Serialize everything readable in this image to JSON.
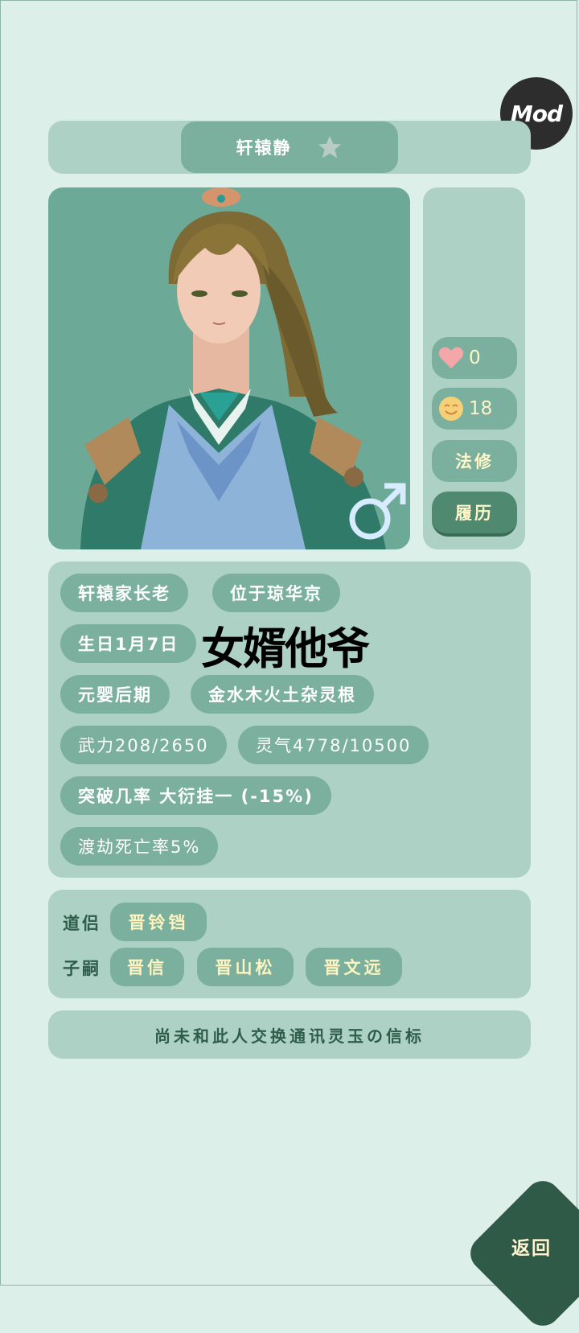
{
  "mod_badge": "Mod",
  "character": {
    "name": "轩辕静",
    "gender_icon": "male-icon"
  },
  "side_stats": {
    "affection": "0",
    "mood": "18"
  },
  "side_buttons": {
    "type": "法修",
    "history": "履历"
  },
  "info_chips": {
    "title": "轩辕家长老",
    "location": "位于琼华京",
    "birthday": "生日1月7日",
    "realm": "元婴后期",
    "root": "金水木火土杂灵根",
    "force": "武力208/2650",
    "qi": "灵气4778/10500",
    "breakthrough": "突破几率 大衍挂一 (-15%)",
    "tribulation": "渡劫死亡率5%"
  },
  "overlay_text": "女婿他爷",
  "relations": {
    "partner_label": "道侣",
    "partner": "晋铃铛",
    "children_label": "子嗣",
    "children": [
      "晋信",
      "晋山松",
      "晋文远"
    ]
  },
  "beacon_text": "尚未和此人交换通讯灵玉の信标",
  "back_button": "返回",
  "colors": {
    "bg": "#dcefe8",
    "panel": "#aed1c6",
    "chip": "#7ab09d",
    "dark": "#2f5a47",
    "accent_text": "#fff4bf"
  }
}
